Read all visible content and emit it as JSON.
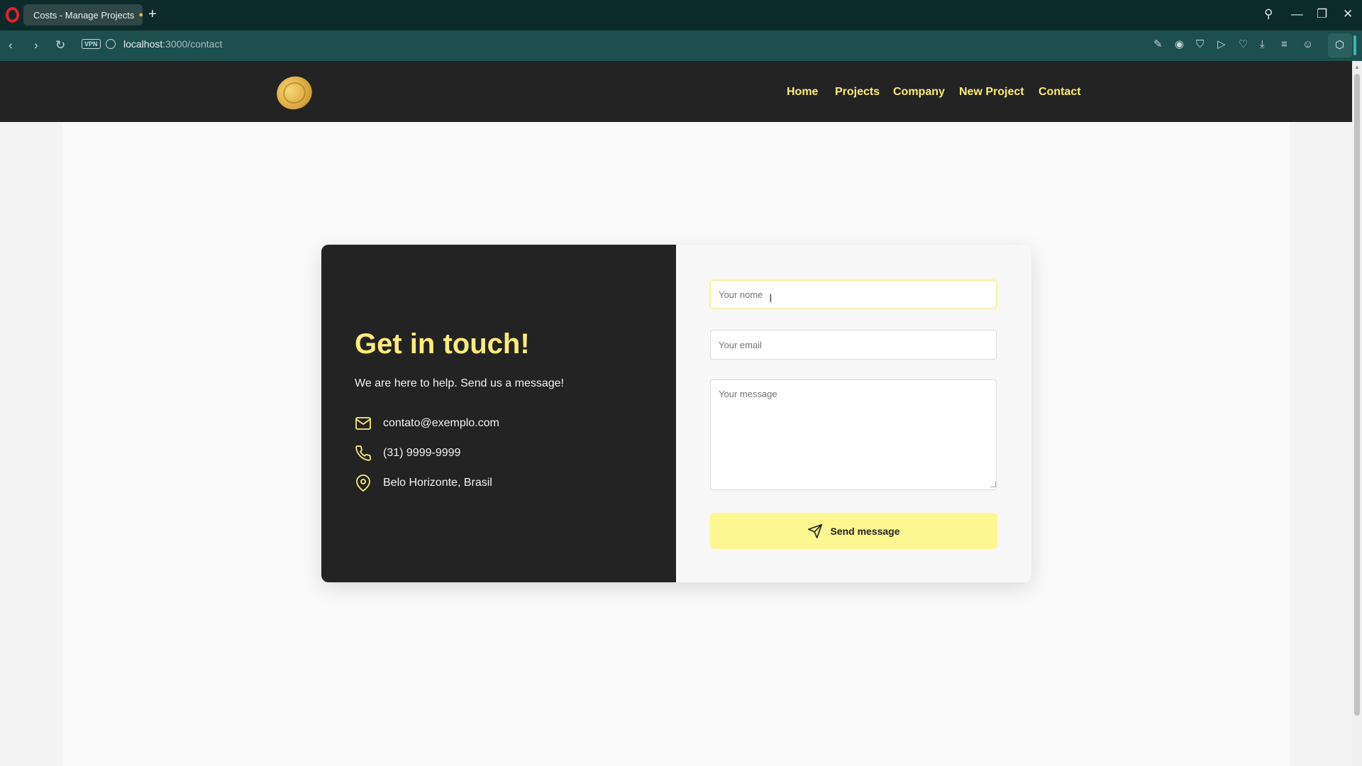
{
  "browser": {
    "tab_title": "Costs - Manage Projects",
    "new_tab_symbol": "+",
    "vpn_label": "VPN",
    "url_host": "localhost",
    "url_path": ":3000/contact"
  },
  "header": {
    "nav": [
      {
        "label": "Home"
      },
      {
        "label": "Projects"
      },
      {
        "label": "Company"
      },
      {
        "label": "New Project"
      },
      {
        "label": "Contact"
      }
    ]
  },
  "contact": {
    "heading": "Get in touch!",
    "subheading": "We are here to help. Send us a message!",
    "email": "contato@exemplo.com",
    "phone": "(31) 9999-9999",
    "location": "Belo Horizonte, Brasil"
  },
  "form": {
    "name_placeholder": "Your nome",
    "email_placeholder": "Your email",
    "message_placeholder": "Your message",
    "submit_label": "Send message"
  },
  "colors": {
    "accent": "#ffec7a",
    "button": "#fdf791",
    "dark": "#232323"
  }
}
